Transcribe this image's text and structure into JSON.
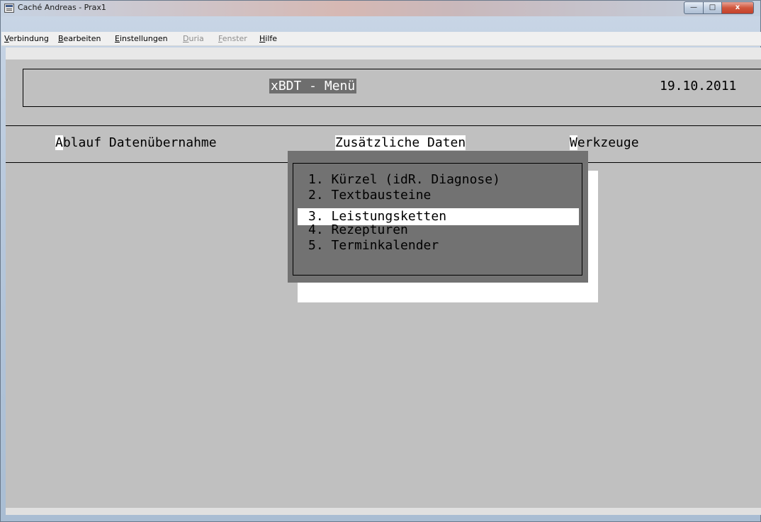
{
  "window": {
    "title": "Caché Andreas - Prax1",
    "buttons": {
      "minimize": "—",
      "maximize": "□",
      "close": "x"
    }
  },
  "menubar": {
    "items": [
      {
        "label": "Verbindung",
        "hotkey": "V",
        "rest": "erbindung",
        "enabled": true
      },
      {
        "label": "Bearbeiten",
        "hotkey": "B",
        "rest": "earbeiten",
        "enabled": true
      },
      {
        "label": "Einstellungen",
        "hotkey": "E",
        "rest": "instellungen",
        "enabled": true
      },
      {
        "label": "Duria",
        "hotkey": "D",
        "rest": "uria",
        "enabled": false
      },
      {
        "label": "Fenster",
        "hotkey": "F",
        "rest": "enster",
        "enabled": false
      },
      {
        "label": "Hilfe",
        "hotkey": "H",
        "rest": "ilfe",
        "enabled": true
      }
    ]
  },
  "screen": {
    "title": "xBDT - Menü",
    "date": "19.10.2011",
    "topmenu": [
      {
        "hotkey": "A",
        "rest": "blauf Datenübernahme"
      },
      {
        "hotkey": "",
        "rest": "Zusätzliche Daten"
      },
      {
        "hotkey": "W",
        "rest": "erkzeuge"
      }
    ],
    "dropdown": {
      "items": [
        "1. Kürzel (idR. Diagnose)",
        "2. Textbausteine",
        "3. Leistungsketten",
        "4. Rezepturen",
        "5. Terminkalender"
      ],
      "selected_index": 2
    }
  },
  "colors": {
    "terminal_bg": "#c0c0c0",
    "dropdown_bg": "#727272",
    "highlight": "#ffffff",
    "title_highlight_bg": "#6e6e6e"
  }
}
